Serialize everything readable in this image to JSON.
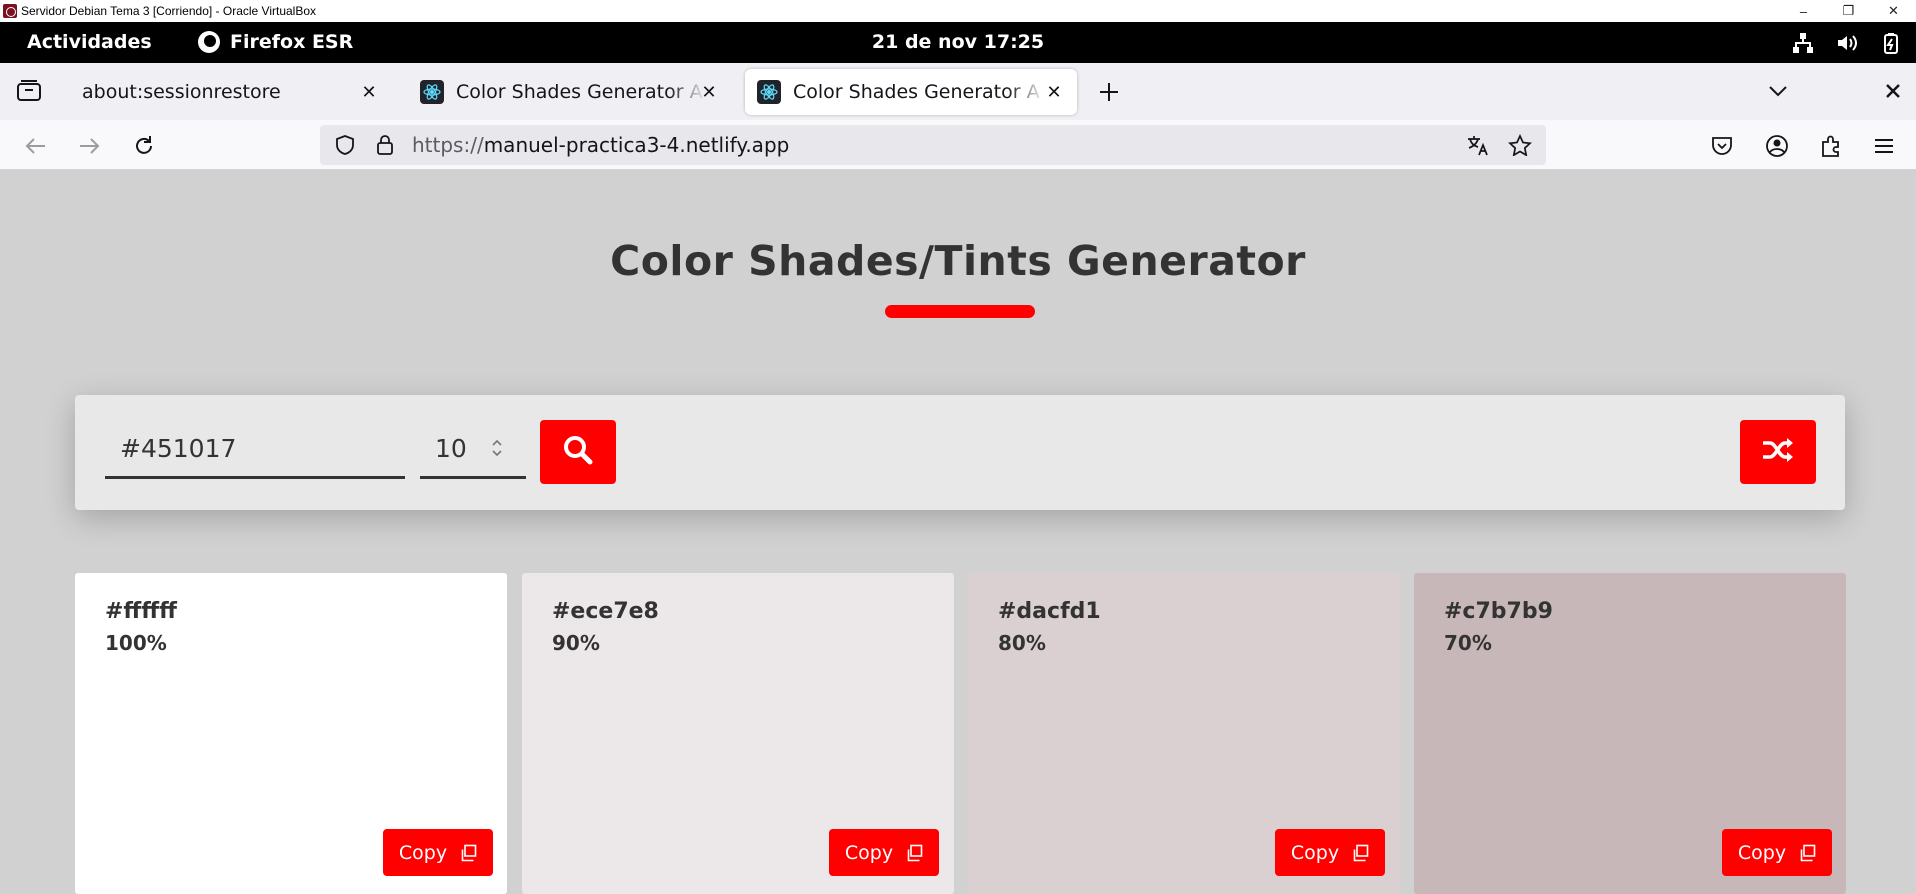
{
  "vbox": {
    "title": "Servidor Debian Tema 3 [Corriendo] - Oracle VirtualBox",
    "minimize": "–",
    "restore": "❐",
    "close": "✕"
  },
  "gnome": {
    "activities": "Actividades",
    "app_name": "Firefox ESR",
    "clock": "21 de nov  17:25"
  },
  "tabs": [
    {
      "label": "about:sessionrestore",
      "close": "✕"
    },
    {
      "label": "Color Shades Generator A",
      "close": "✕"
    },
    {
      "label": "Color Shades Generator A",
      "close": "✕"
    }
  ],
  "navbar": {
    "url_scheme": "https://",
    "url_host": "manuel-practica3-4.netlify.app"
  },
  "page": {
    "title": "Color Shades/Tints Generator",
    "hex_input_value": "#451017",
    "amount_value": "10",
    "accent": "#ff0000"
  },
  "cards": [
    {
      "hex": "#ffffff",
      "percent": "100%",
      "copy_label": "Copy",
      "color": "#ffffff"
    },
    {
      "hex": "#ece7e8",
      "percent": "90%",
      "copy_label": "Copy",
      "color": "#ece7e8"
    },
    {
      "hex": "#dacfd1",
      "percent": "80%",
      "copy_label": "Copy",
      "color": "#dacfd1"
    },
    {
      "hex": "#c7b7b9",
      "percent": "70%",
      "copy_label": "Copy",
      "color": "#c7b7b9"
    }
  ]
}
